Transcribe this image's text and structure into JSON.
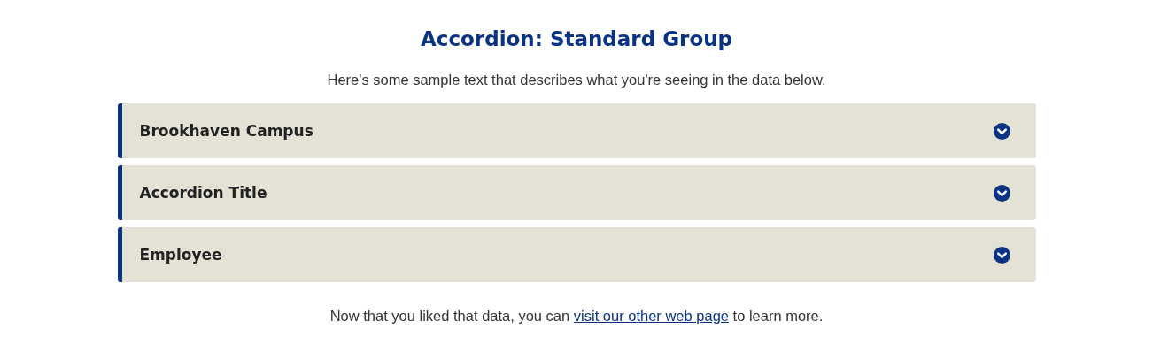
{
  "heading": "Accordion: Standard Group",
  "intro": "Here's some sample text that describes what you're seeing in the data below.",
  "accordion": [
    {
      "title": "Brookhaven Campus",
      "expanded": false
    },
    {
      "title": "Accordion Title",
      "expanded": false
    },
    {
      "title": "Employee",
      "expanded": false
    }
  ],
  "footer": {
    "before": "Now that you liked that data, you can ",
    "link": "visit our other web page",
    "after": " to learn more."
  }
}
